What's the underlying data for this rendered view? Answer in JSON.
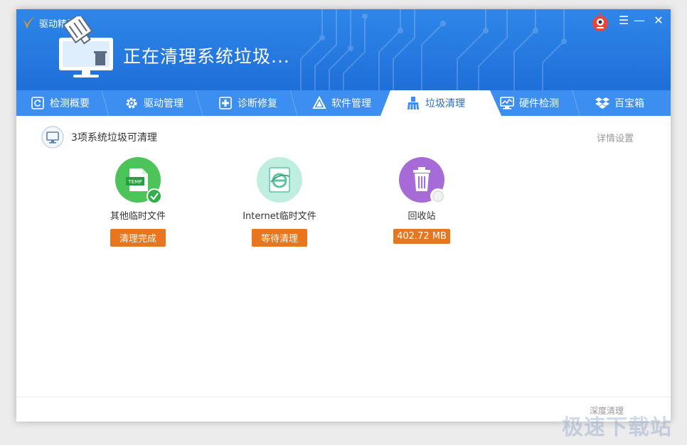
{
  "app": {
    "name": "驱动精灵"
  },
  "header": {
    "status_title": "正在清理系统垃圾..."
  },
  "window_controls": {
    "menu": "☰",
    "minimize": "—",
    "close": "✕"
  },
  "nav": {
    "tabs": [
      {
        "label": "检测概要",
        "icon": "refresh-icon"
      },
      {
        "label": "驱动管理",
        "icon": "gear-icon"
      },
      {
        "label": "诊断修复",
        "icon": "first-aid-icon"
      },
      {
        "label": "软件管理",
        "icon": "triangle-logo-icon"
      },
      {
        "label": "垃圾清理",
        "icon": "broom-icon",
        "active": true
      },
      {
        "label": "硬件检测",
        "icon": "monitor-chart-icon"
      },
      {
        "label": "百宝箱",
        "icon": "dropbox-icon"
      }
    ]
  },
  "content": {
    "summary": "3项系统垃圾可清理",
    "detail_settings": "详情设置",
    "items": [
      {
        "name": "其他临时文件",
        "status": "清理完成",
        "icon": "temp-file-icon",
        "circle_color": "#4cc45a",
        "done": true
      },
      {
        "name": "Internet临时文件",
        "status": "等待清理",
        "icon": "ie-cache-icon",
        "circle_color": "#bfeee0",
        "done": false
      },
      {
        "name": "回收站",
        "status": "402.72 MB",
        "icon": "recycle-bin-icon",
        "circle_color": "#a66bd6",
        "done": false
      }
    ]
  },
  "footer": {
    "deep_clean": "深度清理"
  },
  "watermark": "极速下载站",
  "colors": {
    "header": "#1e6fd9",
    "nav": "#3c8ff0",
    "badge": "#e8761f"
  }
}
